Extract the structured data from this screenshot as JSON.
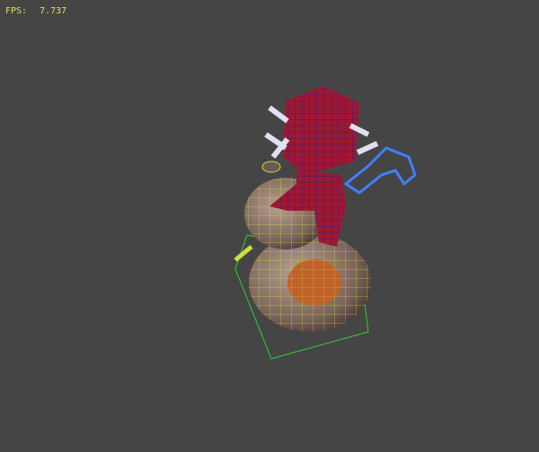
{
  "viewport": {
    "fps_label": "FPS:",
    "fps_value": "7.737",
    "fps_color": "#e6e05a",
    "background": "#454545"
  }
}
